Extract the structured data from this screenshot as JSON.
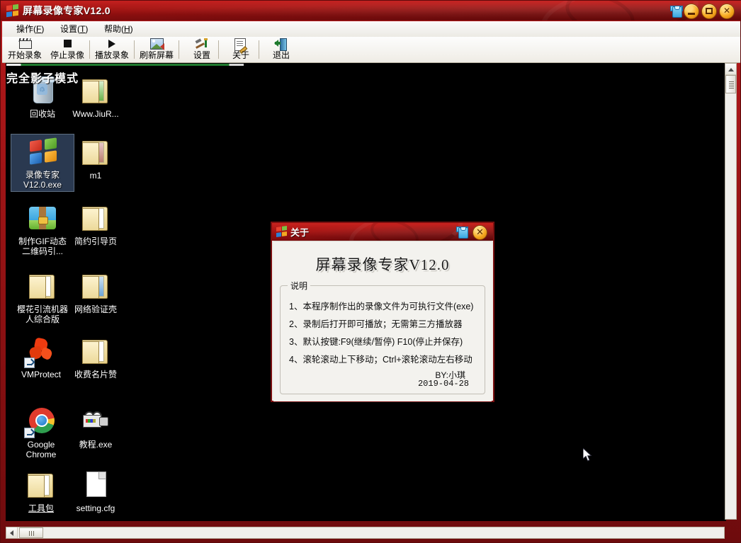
{
  "window": {
    "title": "屏幕录像专家V12.0",
    "icon": "windows-logo-icon",
    "skin_icon": "shirt-icon",
    "minimize_label": "",
    "maximize_label": "",
    "close_label": "✕"
  },
  "menubar": {
    "items": [
      {
        "label": "操作(F)",
        "text": "操作(",
        "mnemonic": "F",
        "tail": ")"
      },
      {
        "label": "设置(T)",
        "text": "设置(",
        "mnemonic": "T",
        "tail": ")"
      },
      {
        "label": "帮助(H)",
        "text": "帮助(",
        "mnemonic": "H",
        "tail": ")"
      }
    ]
  },
  "toolbar": {
    "buttons": [
      {
        "label": "开始录象",
        "icon": "clapperboard-icon"
      },
      {
        "label": "停止录像",
        "icon": "stop-square-icon"
      },
      {
        "label": "播放录象",
        "icon": "play-triangle-icon"
      },
      {
        "label": "刷新屏幕",
        "icon": "picture-refresh-icon"
      },
      {
        "label": "设置",
        "icon": "hammer-screwdriver-icon"
      },
      {
        "label": "关于",
        "icon": "document-pen-icon"
      },
      {
        "label": "退出",
        "icon": "exit-door-icon"
      }
    ]
  },
  "desktop": {
    "watermark": "完全影子模式",
    "icons": [
      {
        "label": "回收站",
        "icon": "recycle-bin-icon",
        "selected": false
      },
      {
        "label": "Www.JiuR...",
        "icon": "folder-green-icon",
        "selected": false
      },
      {
        "label": "录像专家V12.0.exe",
        "label_line1": "录像专家",
        "label_line2": "V12.0.exe",
        "icon": "windows-flag-icon",
        "selected": true
      },
      {
        "label": "m1",
        "icon": "folder-photo-icon",
        "selected": false
      },
      {
        "label": "制作GIF动态二维码引...",
        "label_line1": "制作GIF动态",
        "label_line2": "二维码引...",
        "icon": "gif-tool-icon",
        "selected": false
      },
      {
        "label": "简约引导页",
        "icon": "folder-ie-icon",
        "selected": false
      },
      {
        "label": "樱花引流机器人综合版",
        "label_line1": "樱花引流机器",
        "label_line2": "人综合版",
        "icon": "folder-icon",
        "selected": false
      },
      {
        "label": "网络验证壳",
        "icon": "folder-blue-icon",
        "selected": false
      },
      {
        "label": "VMProtect",
        "icon": "puzzle-shortcut-icon",
        "selected": false
      },
      {
        "label": "收费名片赞",
        "icon": "folder-icon",
        "selected": false
      },
      {
        "label": "Google Chrome",
        "label_line1": "Google",
        "label_line2": "Chrome",
        "icon": "chrome-shortcut-icon",
        "selected": false
      },
      {
        "label": "教程.exe",
        "icon": "camera-icon",
        "selected": false
      },
      {
        "label": "工具包",
        "icon": "folder-icon",
        "selected": false
      },
      {
        "label": "setting.cfg",
        "icon": "file-icon",
        "selected": false
      }
    ]
  },
  "about_dialog": {
    "title": "关于",
    "icon": "windows-logo-icon",
    "skin_icon": "shirt-icon",
    "close_label": "✕",
    "heading": "屏幕录像专家V12.0",
    "group_title": "说明",
    "lines": [
      "1、本程序制作出的录像文件为可执行文件(exe)",
      "2、录制后打开即可播放；无需第三方播放器",
      "3、默认按键:F9(继续/暂停) F10(停止并保存)",
      "4、滚轮滚动上下移动；Ctrl+滚轮滚动左右移动"
    ],
    "signature_by": "BY:小琪",
    "signature_date": "2019-04-28"
  },
  "scrollbars": {
    "vertical_up_arrow": "scroll-up-arrow",
    "horizontal_left_arrow": "scroll-left-arrow"
  },
  "colors": {
    "titlebar_red": "#a81715",
    "accent_orange": "#f6a81e",
    "desktop_black": "#000000",
    "dialog_bg": "#f3f2ee",
    "selection_blue": "#6e96d2"
  }
}
